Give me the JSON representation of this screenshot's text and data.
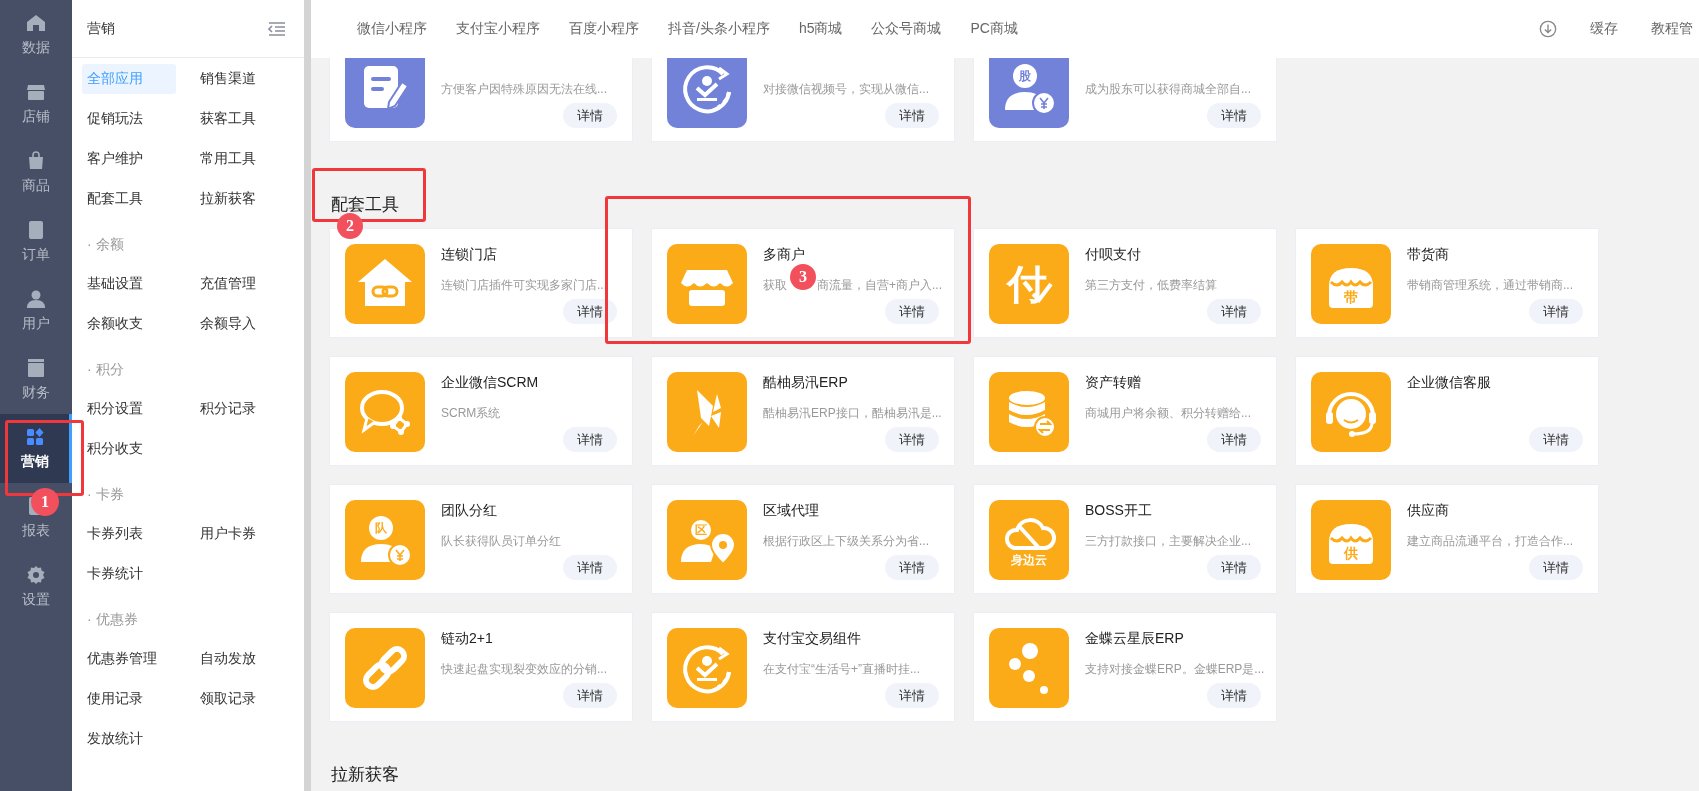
{
  "nav": {
    "items": [
      {
        "label": "数据",
        "selected": false
      },
      {
        "label": "店铺",
        "selected": false
      },
      {
        "label": "商品",
        "selected": false
      },
      {
        "label": "订单",
        "selected": false
      },
      {
        "label": "用户",
        "selected": false
      },
      {
        "label": "财务",
        "selected": false
      },
      {
        "label": "营销",
        "selected": true,
        "annotation": "1"
      },
      {
        "label": "报表",
        "selected": false
      },
      {
        "label": "设置",
        "selected": false
      }
    ]
  },
  "submenu": {
    "title": "营销",
    "groups": [
      {
        "items": [
          {
            "label": "全部应用",
            "selected": true
          },
          {
            "label": "销售渠道",
            "selected": false
          },
          {
            "label": "促销玩法",
            "selected": false
          },
          {
            "label": "获客工具",
            "selected": false
          },
          {
            "label": "客户维护",
            "selected": false
          },
          {
            "label": "常用工具",
            "selected": false
          },
          {
            "label": "配套工具",
            "selected": false
          },
          {
            "label": "拉新获客",
            "selected": false
          }
        ]
      },
      {
        "title": "· 余额",
        "items": [
          {
            "label": "基础设置",
            "selected": false
          },
          {
            "label": "充值管理",
            "selected": false
          },
          {
            "label": "余额收支",
            "selected": false
          },
          {
            "label": "余额导入",
            "selected": false
          }
        ]
      },
      {
        "title": "· 积分",
        "items": [
          {
            "label": "积分设置",
            "selected": false
          },
          {
            "label": "积分记录",
            "selected": false
          },
          {
            "label": "积分收支",
            "selected": false
          }
        ]
      },
      {
        "title": "· 卡券",
        "items": [
          {
            "label": "卡券列表",
            "selected": false
          },
          {
            "label": "用户卡券",
            "selected": false
          },
          {
            "label": "卡券统计",
            "selected": false
          }
        ]
      },
      {
        "title": "· 优惠券",
        "items": [
          {
            "label": "优惠券管理",
            "selected": false
          },
          {
            "label": "自动发放",
            "selected": false
          },
          {
            "label": "使用记录",
            "selected": false
          },
          {
            "label": "领取记录",
            "selected": false
          },
          {
            "label": "发放统计",
            "selected": false
          }
        ]
      }
    ]
  },
  "topbar": {
    "tabs": [
      "微信小程序",
      "支付宝小程序",
      "百度小程序",
      "抖音/头条小程序",
      "h5商城",
      "公众号商城",
      "PC商城"
    ],
    "actions": [
      "缓存",
      "教程管"
    ]
  },
  "sections": [
    {
      "cards": [
        {
          "color": "#7282d9",
          "description": "方便客户因特殊原因无法在线...",
          "button": "详情"
        },
        {
          "color": "#7282d9",
          "description": "对接微信视频号，实现从微信...",
          "button": "详情"
        },
        {
          "color": "#7282d9",
          "icon_text": "股",
          "description": "成为股东可以获得商城全部自...",
          "button": "详情"
        }
      ]
    },
    {
      "title": "配套工具",
      "annotation": "2",
      "cards": [
        {
          "color": "#fbab18",
          "title": "连锁门店",
          "description": "连锁门店插件可实现多家门店...",
          "button": "详情"
        },
        {
          "color": "#fbab18",
          "title": "多商户",
          "description": "获取",
          "annotation": "3",
          "description_rest": "商流量，自营+商户入...",
          "button": "详情"
        },
        {
          "color": "#fbab18",
          "icon_text": "付",
          "title": "付呗支付",
          "description": "第三方支付，低费率结算",
          "button": "详情"
        },
        {
          "color": "#fbab18",
          "icon_text": "带",
          "title": "带货商",
          "description": "带销商管理系统，通过带销商...",
          "button": "详情"
        },
        {
          "color": "#fbab18",
          "title": "企业微信SCRM",
          "description": "SCRM系统",
          "button": "详情"
        },
        {
          "color": "#fbab18",
          "title": "酷柚易汛ERP",
          "description": "酷柚易汛ERP接口，酷柚易汛是...",
          "button": "详情"
        },
        {
          "color": "#fbab18",
          "title": "资产转赠",
          "description": "商城用户将余额、积分转赠给...",
          "button": "详情"
        },
        {
          "color": "#fbab18",
          "title": "企业微信客服",
          "button": "详情"
        },
        {
          "color": "#fbab18",
          "icon_text": "队",
          "title": "团队分红",
          "description": "队长获得队员订单分红",
          "button": "详情"
        },
        {
          "color": "#fbab18",
          "icon_text": "区",
          "title": "区域代理",
          "description": "根据行政区上下级关系分为省...",
          "button": "详情"
        },
        {
          "color": "#fbab18",
          "icon_text": "身边云",
          "title": "BOSS开工",
          "description": "三方打款接口，主要解决企业...",
          "button": "详情"
        },
        {
          "color": "#fbab18",
          "icon_text": "供",
          "title": "供应商",
          "description": "建立商品流通平台，打造合作...",
          "button": "详情"
        },
        {
          "color": "#fbab18",
          "title": "链动2+1",
          "description": "快速起盘实现裂变效应的分销...",
          "button": "详情"
        },
        {
          "color": "#fbab18",
          "title": "支付宝交易组件",
          "description": "在支付宝“生活号+”直播时挂...",
          "button": "详情"
        },
        {
          "color": "#fbab18",
          "title": "金蝶云星辰ERP",
          "description": "支持对接金蝶ERP。金蝶ERP是...",
          "button": "详情"
        }
      ]
    },
    {
      "title": "拉新获客"
    }
  ]
}
